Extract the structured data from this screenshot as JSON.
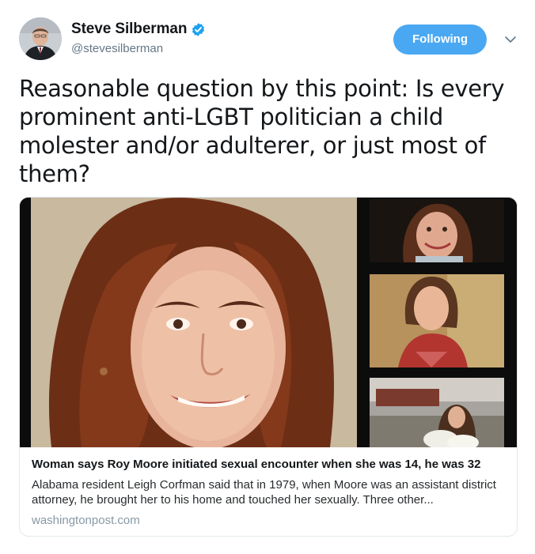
{
  "author": {
    "display_name": "Steve Silberman",
    "handle": "@stevesilberman",
    "verified": true,
    "avatar_icon": "avatar-photo"
  },
  "actions": {
    "follow_label": "Following",
    "menu_icon": "chevron-down-icon"
  },
  "tweet": {
    "text": "Reasonable question by this point: Is every prominent anti-LGBT politician a child molester and/or adulterer, or just most of them?"
  },
  "card": {
    "title": "Woman says Roy Moore initiated sexual encounter when she was 14, he was 32",
    "description": "Alabama resident Leigh Corfman said that in 1979, when Moore was an assistant district attorney, he brought her to his home and touched her sexually. Three other...",
    "domain": "washingtonpost.com"
  },
  "colors": {
    "accent": "#4aa8f2",
    "verified": "#1da1f2",
    "muted": "#657786",
    "domain": "#8899a6",
    "border": "#e1e8ed"
  }
}
